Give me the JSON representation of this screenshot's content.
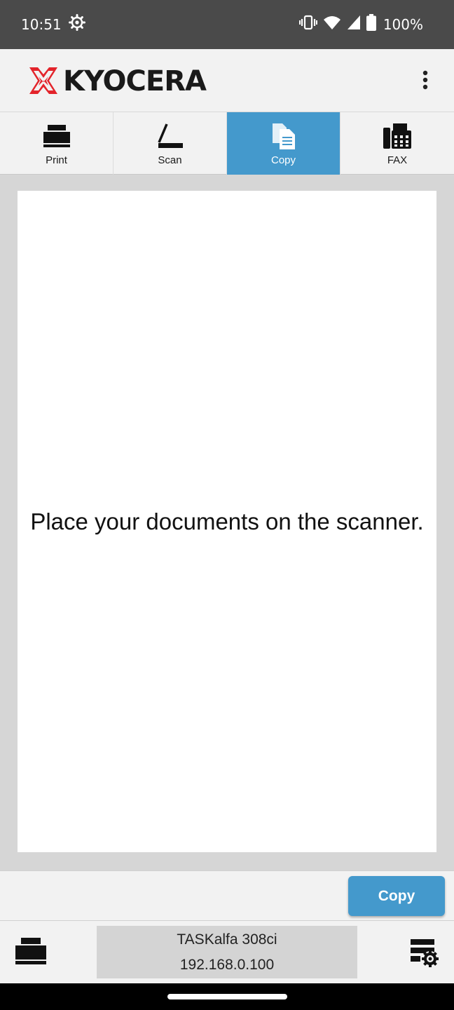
{
  "status_bar": {
    "time": "10:51",
    "battery": "100%",
    "icons": [
      "settings-icon",
      "vibrate-icon",
      "wifi-icon",
      "signal-icon",
      "battery-icon"
    ]
  },
  "header": {
    "brand": "KYOCERA",
    "brand_color": "#e3242b",
    "menu_icon": "more-vertical-icon"
  },
  "tabs": [
    {
      "label": "Print",
      "icon": "printer-icon",
      "active": false
    },
    {
      "label": "Scan",
      "icon": "scanner-icon",
      "active": false
    },
    {
      "label": "Copy",
      "icon": "copy-icon",
      "active": true
    },
    {
      "label": "FAX",
      "icon": "fax-icon",
      "active": false
    }
  ],
  "accent_color": "#4499cc",
  "preview": {
    "message": "Place your documents on the scanner."
  },
  "actions": {
    "copy_label": "Copy"
  },
  "device": {
    "name": "TASKalfa 308ci",
    "ip": "192.168.0.100"
  }
}
